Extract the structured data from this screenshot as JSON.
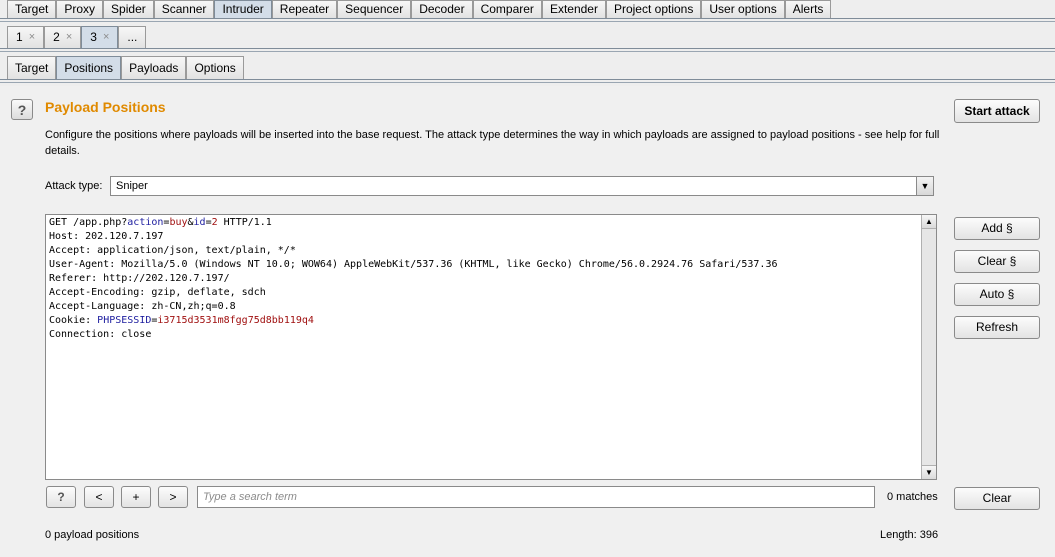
{
  "top_tabs": [
    "Target",
    "Proxy",
    "Spider",
    "Scanner",
    "Intruder",
    "Repeater",
    "Sequencer",
    "Decoder",
    "Comparer",
    "Extender",
    "Project options",
    "User options",
    "Alerts"
  ],
  "top_tab_selected": "Intruder",
  "number_tabs": [
    {
      "label": "1",
      "close": "×"
    },
    {
      "label": "2",
      "close": "×"
    },
    {
      "label": "3",
      "close": "×"
    }
  ],
  "number_tab_more": "...",
  "sub_tabs": [
    "Target",
    "Positions",
    "Payloads",
    "Options"
  ],
  "panel": {
    "help_label": "?",
    "title": "Payload Positions",
    "description": "Configure the positions where payloads will be inserted into the base request. The attack type determines the way in which payloads are assigned to payload positions - see help for full details.",
    "attack_type_label": "Attack type:",
    "attack_type_value": "Sniper",
    "start_attack": "Start attack",
    "side_buttons": {
      "add": "Add §",
      "clear": "Clear §",
      "auto": "Auto §",
      "refresh": "Refresh"
    },
    "request_lines": [
      [
        {
          "t": "GET /app.php?"
        },
        {
          "t": "action",
          "c": "k"
        },
        {
          "t": "="
        },
        {
          "t": "buy",
          "c": "v"
        },
        {
          "t": "&"
        },
        {
          "t": "id",
          "c": "k"
        },
        {
          "t": "="
        },
        {
          "t": "2",
          "c": "v"
        },
        {
          "t": " HTTP/1.1"
        }
      ],
      [
        {
          "t": "Host: 202.120.7.197"
        }
      ],
      [
        {
          "t": "Accept: application/json, text/plain, */*"
        }
      ],
      [
        {
          "t": "User-Agent: Mozilla/5.0 (Windows NT 10.0; WOW64) AppleWebKit/537.36 (KHTML, like Gecko) Chrome/56.0.2924.76 Safari/537.36"
        }
      ],
      [
        {
          "t": "Referer: http://202.120.7.197/"
        }
      ],
      [
        {
          "t": "Accept-Encoding: gzip, deflate, sdch"
        }
      ],
      [
        {
          "t": "Accept-Language: zh-CN,zh;q=0.8"
        }
      ],
      [
        {
          "t": "Cookie: "
        },
        {
          "t": "PHPSESSID",
          "c": "k"
        },
        {
          "t": "="
        },
        {
          "t": "i3715d3531m8fgg75d8bb119q4",
          "c": "v"
        }
      ],
      [
        {
          "t": "Connection: close"
        }
      ]
    ],
    "search": {
      "help": "?",
      "prev": "<",
      "add": "+",
      "next": ">",
      "placeholder": "Type a search term",
      "matches": "0 matches",
      "clear": "Clear"
    },
    "payload_positions": "0 payload positions",
    "length": "Length: 396"
  }
}
